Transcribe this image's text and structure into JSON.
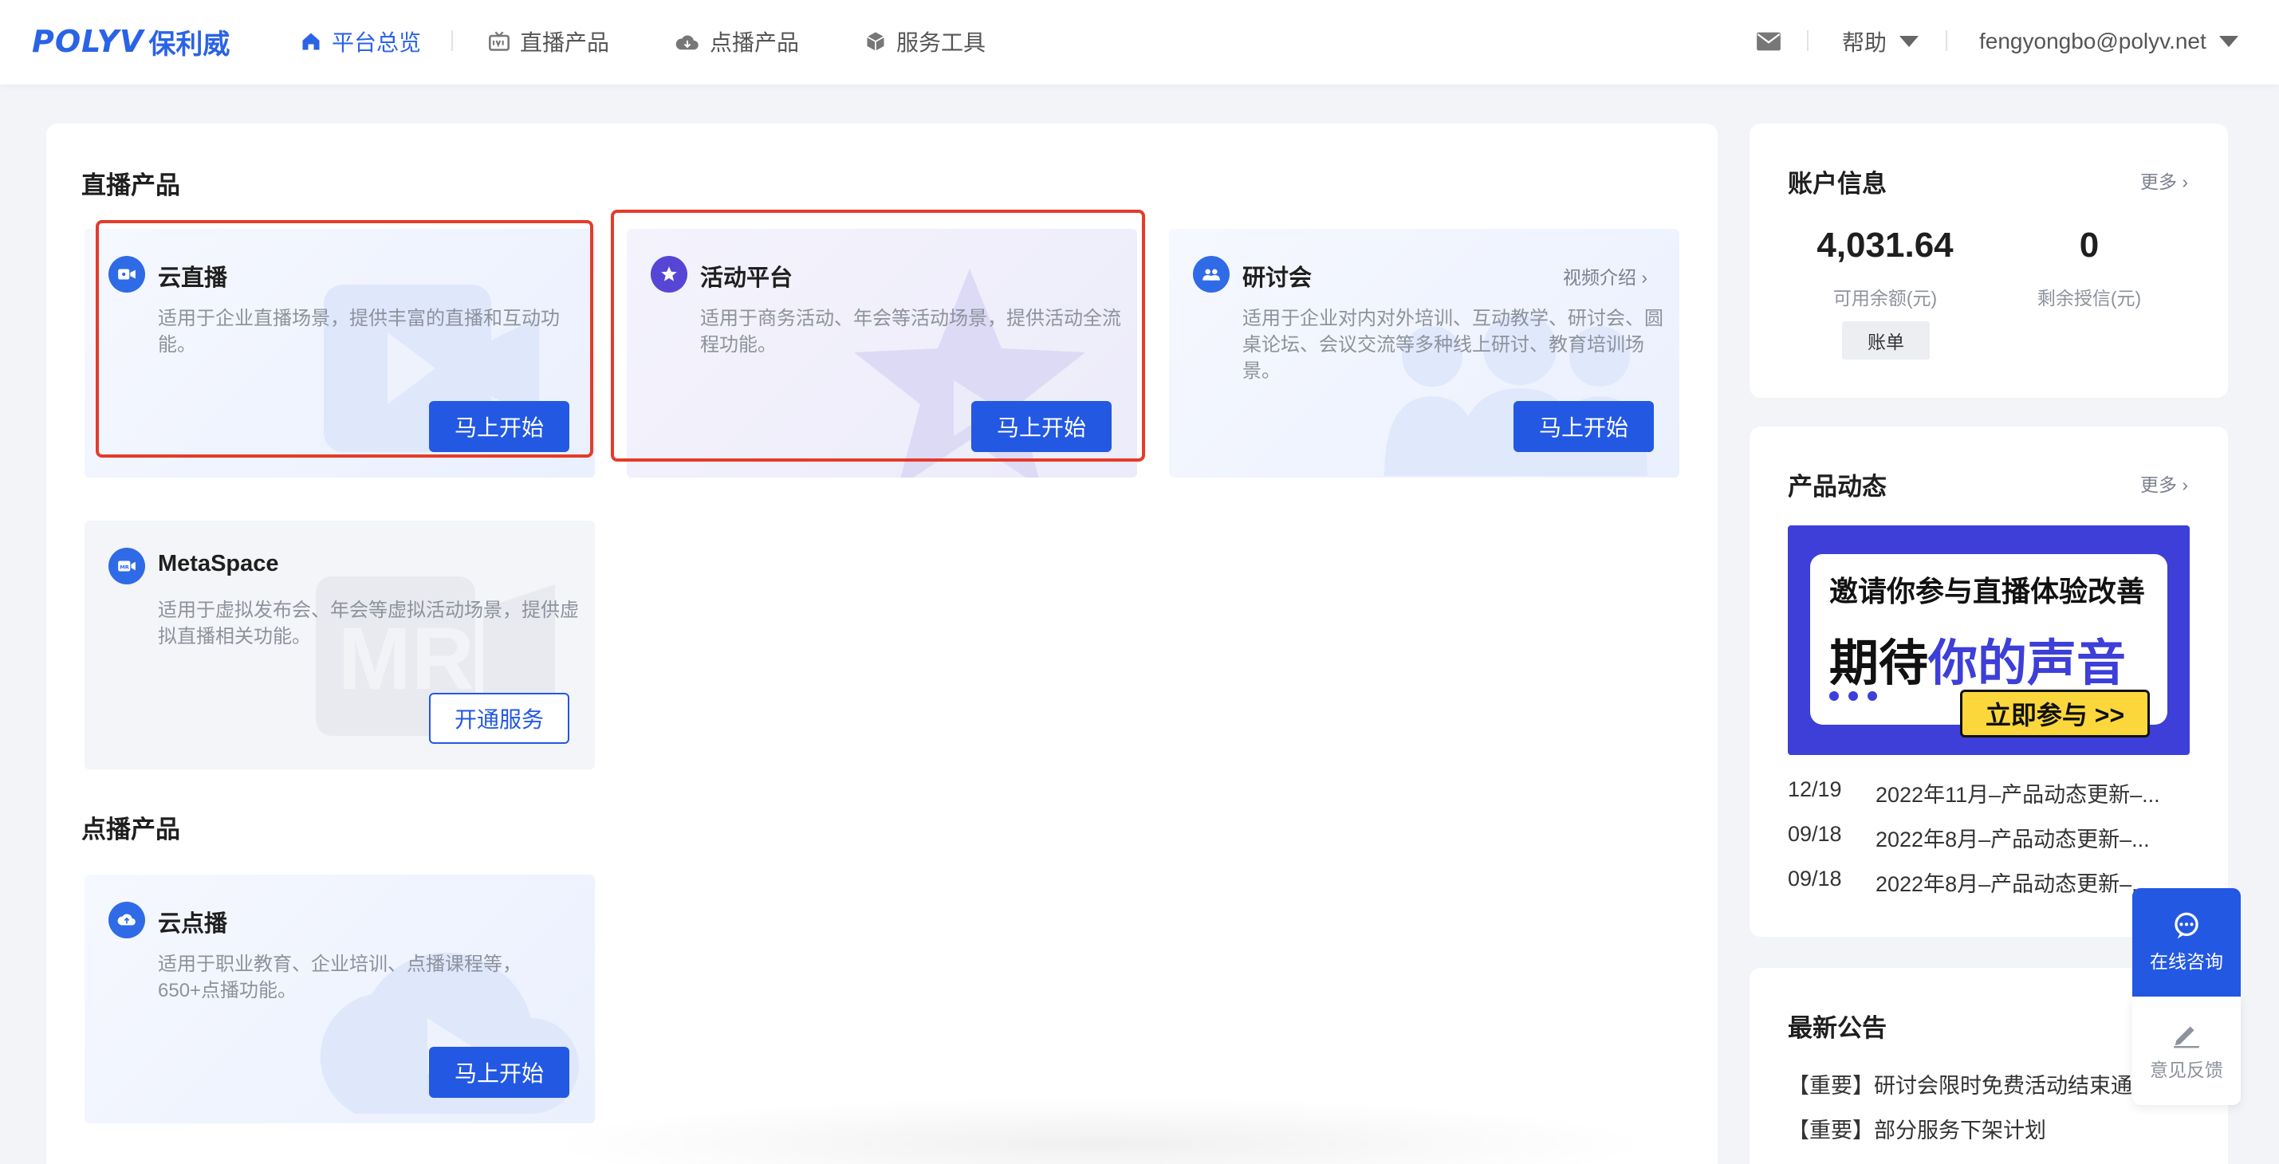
{
  "brand": {
    "logo_mark": "POLYV",
    "logo_cn": "保利威"
  },
  "nav": {
    "items": [
      {
        "label": "平台总览",
        "icon": "home-icon",
        "active": true
      },
      {
        "label": "直播产品",
        "icon": "live-icon",
        "active": false
      },
      {
        "label": "点播产品",
        "icon": "cloud-icon",
        "active": false
      },
      {
        "label": "服务工具",
        "icon": "box-icon",
        "active": false
      }
    ],
    "help_label": "帮助",
    "user_email": "fengyongbo@polyv.net"
  },
  "live_section": {
    "title": "直播产品",
    "cards": [
      {
        "title": "云直播",
        "desc": "适用于企业直播场景，提供丰富的直播和互动功能。",
        "button": "马上开始"
      },
      {
        "title": "活动平台",
        "desc": "适用于商务活动、年会等活动场景，提供活动全流程功能。",
        "button": "马上开始"
      },
      {
        "title": "研讨会",
        "desc": "适用于企业对内对外培训、互动教学、研讨会、圆桌论坛、会议交流等多种线上研讨、教育培训场景。",
        "button": "马上开始",
        "link": "视频介绍"
      },
      {
        "title": "MetaSpace",
        "desc": "适用于虚拟发布会、年会等虚拟活动场景，提供虚拟直播相关功能。",
        "button": "开通服务",
        "bg_text": "MR"
      }
    ]
  },
  "vod_section": {
    "title": "点播产品",
    "cards": [
      {
        "title": "云点播",
        "desc": "适用于职业教育、企业培训、点播课程等，650+点播功能。",
        "button": "马上开始"
      }
    ]
  },
  "account": {
    "title": "账户信息",
    "more": "更多",
    "balance_value": "4,031.64",
    "balance_label": "可用余额(元)",
    "credit_value": "0",
    "credit_label": "剩余授信(元)",
    "bill_button": "账单"
  },
  "product_news": {
    "title": "产品动态",
    "more": "更多",
    "banner": {
      "line1": "邀请你参与直播体验改善",
      "line2_prefix": "期待",
      "line2_highlight": "你的声音",
      "cta": "立即参与 >>"
    },
    "items": [
      {
        "date": "12/19",
        "text": "2022年11月–产品动态更新–..."
      },
      {
        "date": "09/18",
        "text": "2022年8月–产品动态更新–..."
      },
      {
        "date": "09/18",
        "text": "2022年8月–产品动态更新–..."
      }
    ]
  },
  "notices": {
    "title": "最新公告",
    "items": [
      {
        "text": "【重要】研讨会限时免费活动结束通"
      },
      {
        "text": "【重要】部分服务下架计划"
      }
    ]
  },
  "float": {
    "chat_label": "在线咨询",
    "feedback_label": "意见反馈"
  },
  "colors": {
    "primary": "#2358e2",
    "highlight_border": "#e53b2a",
    "banner_bg": "#3d3fd8",
    "banner_cta": "#fcd73c"
  }
}
